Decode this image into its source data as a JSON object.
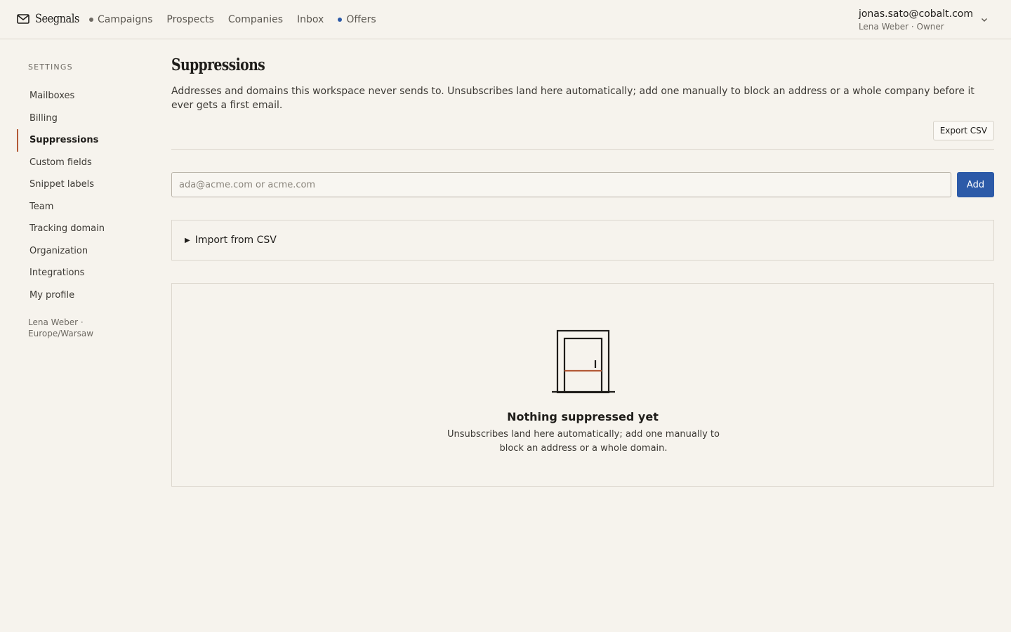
{
  "brand": {
    "name": "Seegnals",
    "icon": "envelope-icon"
  },
  "nav": {
    "items": [
      {
        "label": "Campaigns",
        "dot": "gray"
      },
      {
        "label": "Prospects"
      },
      {
        "label": "Companies"
      },
      {
        "label": "Inbox"
      },
      {
        "label": "Offers",
        "dot": "blue"
      }
    ]
  },
  "account": {
    "email": "jonas.sato@cobalt.com",
    "subtitle": "Lena Weber · Owner",
    "menu_icon": "chevron-down-icon"
  },
  "sidebar": {
    "heading": "SETTINGS",
    "items": [
      {
        "label": "Mailboxes"
      },
      {
        "label": "Billing"
      },
      {
        "label": "Suppressions",
        "active": true
      },
      {
        "label": "Custom fields"
      },
      {
        "label": "Snippet labels"
      },
      {
        "label": "Team"
      },
      {
        "label": "Tracking domain"
      },
      {
        "label": "Organization"
      },
      {
        "label": "Integrations"
      },
      {
        "label": "My profile"
      }
    ],
    "footer": "Lena Weber · Europe/Warsaw"
  },
  "main": {
    "title": "Suppressions",
    "description": "Addresses and domains this workspace never sends to. Unsubscribes land here automatically; add one manually to block an address or a whole company before it ever gets a first email.",
    "export_label": "Export CSV",
    "input": {
      "placeholder": "ada@acme.com or acme.com",
      "value": ""
    },
    "add_label": "Add",
    "import_label": "Import from CSV",
    "empty": {
      "icon": "door-icon",
      "title": "Nothing suppressed yet",
      "text": "Unsubscribes land here automatically; add one manually to block an address or a whole domain."
    }
  },
  "colors": {
    "background": "#f6f3ed",
    "accent": "#2c5aa8",
    "active_marker": "#b35a37",
    "border": "#dcd7ce"
  }
}
